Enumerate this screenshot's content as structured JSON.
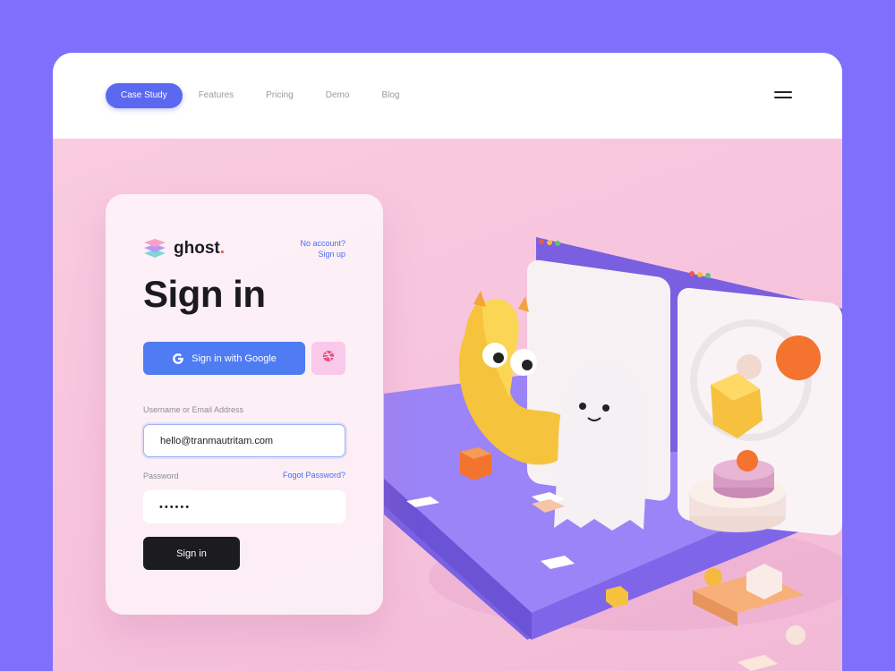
{
  "nav": {
    "items": [
      {
        "label": "Case Study",
        "active": true
      },
      {
        "label": "Features"
      },
      {
        "label": "Pricing"
      },
      {
        "label": "Demo"
      },
      {
        "label": "Blog"
      }
    ],
    "menu_icon": "hamburger-menu-icon"
  },
  "login": {
    "brand_name": "ghost",
    "brand_dot": ".",
    "no_account_line1": "No account?",
    "no_account_line2": "Sign up",
    "title": "Sign in",
    "google_button": "Sign in with Google",
    "username_label": "Username or Email Address",
    "username_value": "hello@tranmautritam.com",
    "password_label": "Password",
    "forgot_password": "Fogot Password?",
    "password_value": "••••••",
    "submit": "Sign in"
  },
  "colors": {
    "background": "#7f6ffb",
    "accent": "#5b68f0",
    "google_blue": "#4f7cf2",
    "hero_pink": "#f7c6dd",
    "platform_purple": "#8a72f0"
  },
  "icons": [
    "layers-logo-icon",
    "google-g-icon",
    "dribbble-icon",
    "hamburger-menu-icon"
  ]
}
